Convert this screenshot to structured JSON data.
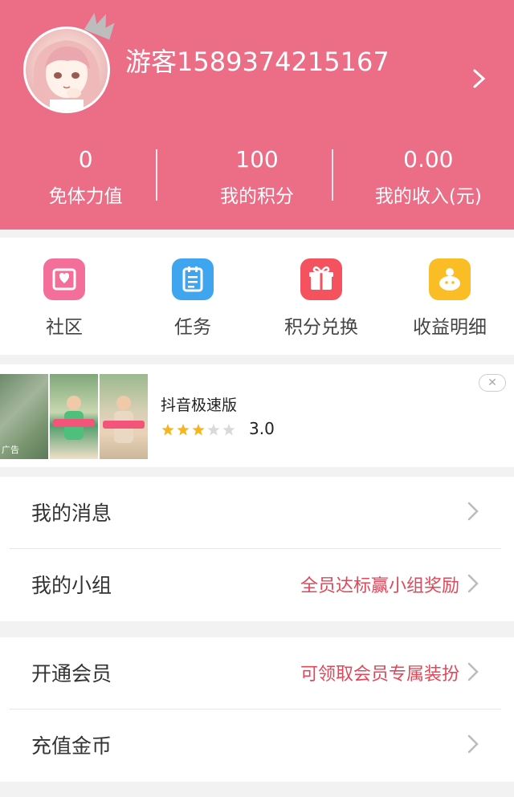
{
  "profile": {
    "username": "游客1589374215167"
  },
  "stats": [
    {
      "value": "0",
      "label": "免体力值"
    },
    {
      "value": "100",
      "label": "我的积分"
    },
    {
      "value": "0.00",
      "label": "我的收入(元)"
    }
  ],
  "quick_actions": [
    {
      "label": "社区",
      "icon": "community-icon",
      "color": "#f36f9a"
    },
    {
      "label": "任务",
      "icon": "task-icon",
      "color": "#3fa5ef"
    },
    {
      "label": "积分兑换",
      "icon": "gift-icon",
      "color": "#f4525f"
    },
    {
      "label": "收益明细",
      "icon": "piggy-bank-icon",
      "color": "#fbbd25"
    }
  ],
  "ad": {
    "badge": "广告",
    "app_name": "抖音极速版",
    "rating": "3.0",
    "rating_stars": 3,
    "max_stars": 5,
    "close_symbol": "✕"
  },
  "menu_group_1": [
    {
      "label": "我的消息",
      "hint": ""
    },
    {
      "label": "我的小组",
      "hint": "全员达标赢小组奖励"
    }
  ],
  "menu_group_2": [
    {
      "label": "开通会员",
      "hint": "可领取会员专属装扮"
    },
    {
      "label": "充值金币",
      "hint": ""
    }
  ],
  "colors": {
    "header_bg": "#ec6d86",
    "hint_red": "#e0485a",
    "star_gold": "#f6b51d"
  }
}
